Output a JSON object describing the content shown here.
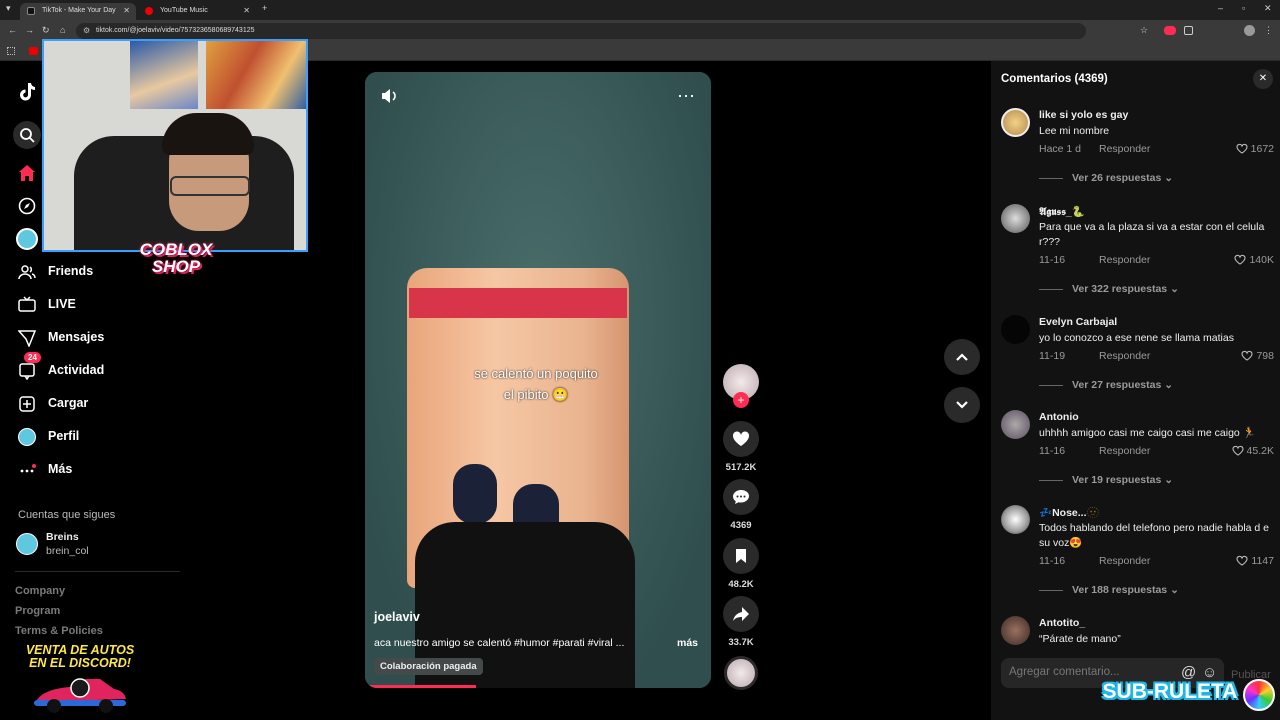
{
  "browser": {
    "tabs": [
      {
        "label": "TikTok - Make Your Day",
        "active": true
      },
      {
        "label": "YouTube Music",
        "active": false
      }
    ],
    "url": "tiktok.com/@joelaviv/video/7573236580689743125"
  },
  "sidebar": {
    "items": [
      {
        "label": "Friends",
        "icon": "friends-icon"
      },
      {
        "label": "LIVE",
        "icon": "live-icon"
      },
      {
        "label": "Mensajes",
        "icon": "messages-icon"
      },
      {
        "label": "Actividad",
        "icon": "activity-icon",
        "badge": "24"
      },
      {
        "label": "Cargar",
        "icon": "upload-icon"
      },
      {
        "label": "Perfil",
        "icon": "profile-icon"
      },
      {
        "label": "Más",
        "icon": "more-icon"
      }
    ],
    "following_title": "Cuentas que sigues",
    "following": {
      "name": "Breins",
      "handle": "brein_col"
    },
    "footer": [
      "Company",
      "Program",
      "Terms & Policies"
    ]
  },
  "video": {
    "overlay_text_line1": "se calentó un poquito",
    "overlay_text_line2": "el pibito 😬",
    "author": "joelaviv",
    "caption": "aca nuestro amigo se calentó #humor #parati #viral ...",
    "more_label": "más",
    "paid_label": "Colaboración pagada",
    "progress": 0.32
  },
  "actions": {
    "likes": "517.2K",
    "comments": "4369",
    "saves": "48.2K",
    "shares": "33.7K"
  },
  "comments_panel": {
    "title": "Comentarios (4369)",
    "items": [
      {
        "user": "like si yolo es gay",
        "text": "Lee mi nombre",
        "date": "Hace 1 d",
        "reply": "Responder",
        "likes": "1672",
        "more": "Ver 26 respuestas"
      },
      {
        "user": "𝕬𝖌𝖚𝖘𝖘_🐍",
        "text": "Para que va a la plaza si va a estar con el celula r???",
        "date": "11-16",
        "reply": "Responder",
        "likes": "140K",
        "more": "Ver 322 respuestas"
      },
      {
        "user": "Evelyn Carbajal",
        "text": "yo lo conozco a ese nene se llama matias",
        "date": "11-19",
        "reply": "Responder",
        "likes": "798",
        "more": "Ver 27 respuestas"
      },
      {
        "user": "Antonio",
        "text": "uhhhh amigoo casi me caigo casi me caigo 🏃",
        "date": "11-16",
        "reply": "Responder",
        "likes": "45.2K",
        "more": "Ver 19 respuestas"
      },
      {
        "user": "💤Nose...🫥",
        "text": "Todos hablando del telefono pero nadie habla d e su voz😍",
        "date": "11-16",
        "reply": "Responder",
        "likes": "1147",
        "more": "Ver 188 respuestas"
      },
      {
        "user": "Antotito_",
        "text": "“Párate de mano”",
        "date": "",
        "reply": "",
        "likes": "",
        "more": ""
      }
    ],
    "input_placeholder": "Agregar comentario...",
    "publish_label": "Publicar"
  },
  "stream_overlays": {
    "coblox_line1": "COBLOX",
    "coblox_line2": "SHOP",
    "autos_line1": "VENTA DE AUTOS",
    "autos_line2": "EN EL DISCORD!",
    "subruleta": "SUB-RULETA"
  },
  "colors": {
    "accent": "#fe2c55",
    "panel_bg": "#121212",
    "webcam_border": "#3aa0ff"
  }
}
